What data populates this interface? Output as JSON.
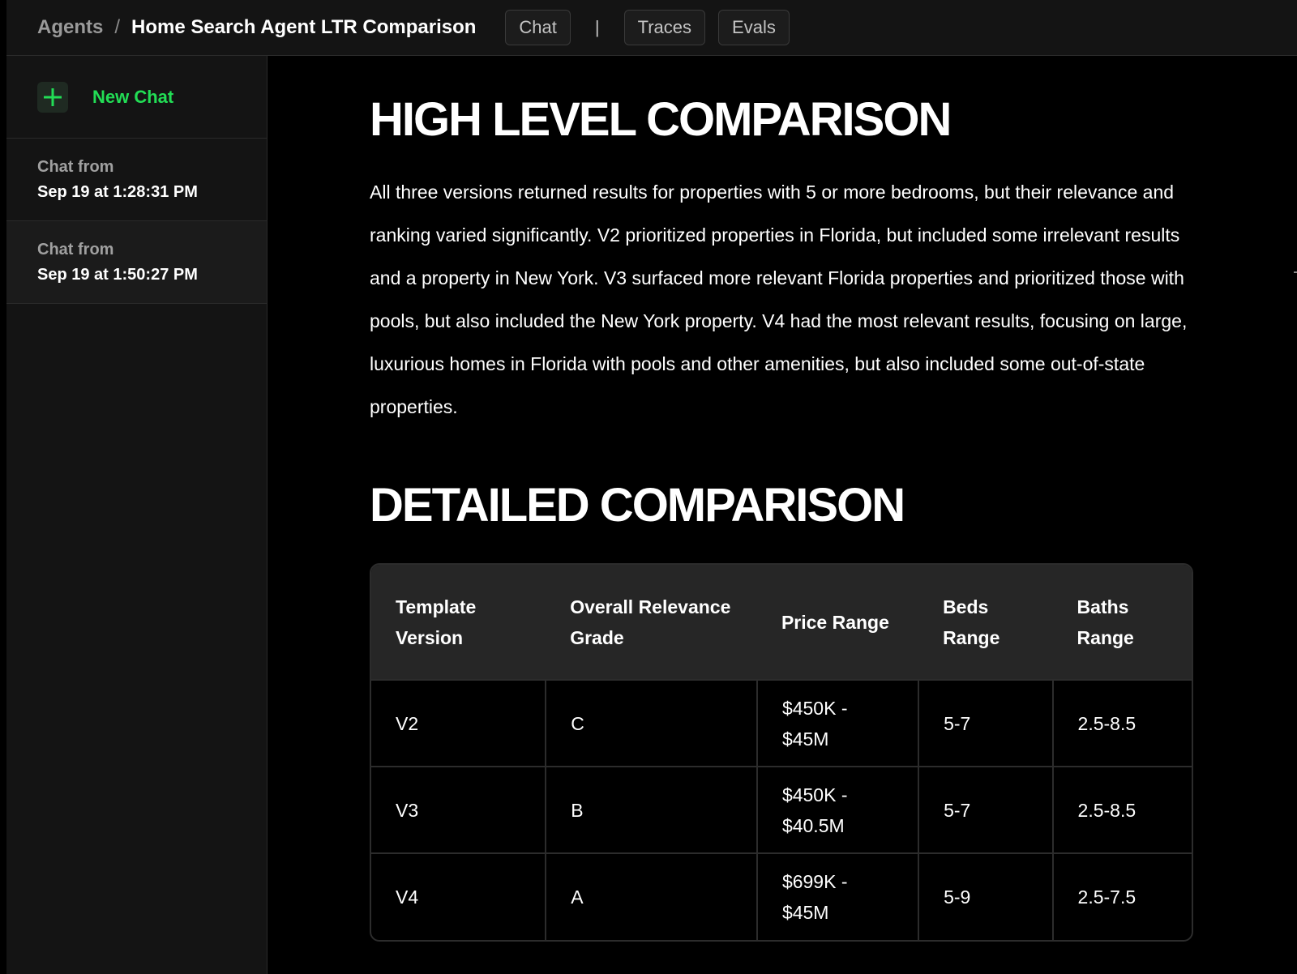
{
  "header": {
    "breadcrumb_root": "Agents",
    "breadcrumb_sep": "/",
    "title": "Home Search Agent LTR Comparison",
    "tabs": [
      {
        "label": "Chat"
      },
      {
        "label": "|"
      },
      {
        "label": "Traces"
      },
      {
        "label": "Evals"
      }
    ]
  },
  "sidebar": {
    "new_chat_label": "New Chat",
    "chats": [
      {
        "prefix": "Chat from",
        "time": "Sep 19 at 1:28:31 PM"
      },
      {
        "prefix": "Chat from",
        "time": "Sep 19 at 1:50:27 PM"
      }
    ]
  },
  "main": {
    "high_level_title": "HIGH LEVEL COMPARISON",
    "high_level_text": "All three versions returned results for properties with 5 or more bedrooms, but their relevance and ranking varied significantly. V2 prioritized properties in Florida, but included some irrelevant results and a property in New York. V3 surfaced more relevant Florida properties and prioritized those with pools, but also included the New York property. V4 had the most relevant results, focusing on large, luxurious homes in Florida with pools and other amenities, but also included some out-of-state properties.",
    "detailed_title": "DETAILED COMPARISON",
    "table": {
      "headers": [
        "Template Version",
        "Overall Relevance Grade",
        "Price Range",
        "Beds Range",
        "Baths Range"
      ],
      "rows": [
        [
          "V2",
          "C",
          "$450K - $45M",
          "5-7",
          "2.5-8.5"
        ],
        [
          "V3",
          "B",
          "$450K - $40.5M",
          "5-7",
          "2.5-8.5"
        ],
        [
          "V4",
          "A",
          "$699K - $45M",
          "5-9",
          "2.5-7.5"
        ]
      ]
    }
  },
  "colors": {
    "accent_green": "#22dd55",
    "background": "#000000",
    "panel": "#141414"
  },
  "icons": {
    "new_chat": "plus-icon"
  }
}
